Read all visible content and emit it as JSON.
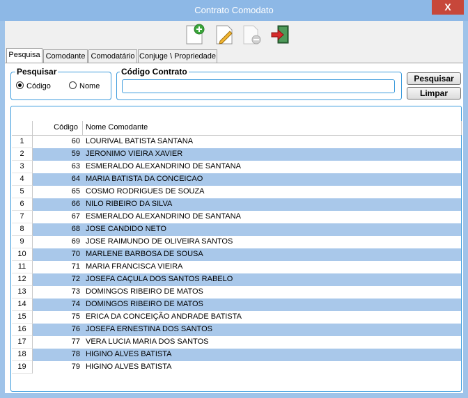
{
  "window": {
    "title": "Contrato Comodato",
    "close_label": "X"
  },
  "toolbar": {
    "buttons": [
      {
        "name": "add-document-icon"
      },
      {
        "name": "edit-document-icon"
      },
      {
        "name": "remove-document-icon"
      },
      {
        "name": "exit-icon"
      }
    ]
  },
  "tabs": [
    {
      "label": "Pesquisa",
      "active": true
    },
    {
      "label": "Comodante"
    },
    {
      "label": "Comodatário"
    },
    {
      "label": "Conjuge \\ Propriedade"
    }
  ],
  "search": {
    "group_label": "Pesquisar",
    "option_codigo": "Código",
    "option_nome": "Nome",
    "selected": "Código",
    "contract_label": "Código Contrato",
    "contract_value": "",
    "search_button": "Pesquisar",
    "clear_button": "Limpar"
  },
  "grid": {
    "headers": {
      "code": "Código",
      "name": "Nome Comodante"
    },
    "rows": [
      {
        "n": "1",
        "code": "60",
        "name": "LOURIVAL BATISTA SANTANA"
      },
      {
        "n": "2",
        "code": "59",
        "name": "JERONIMO VIEIRA XAVIER"
      },
      {
        "n": "3",
        "code": "63",
        "name": "ESMERALDO ALEXANDRINO DE SANTANA"
      },
      {
        "n": "4",
        "code": "64",
        "name": "MARIA BATISTA DA CONCEICAO"
      },
      {
        "n": "5",
        "code": "65",
        "name": "COSMO RODRIGUES DE SOUZA"
      },
      {
        "n": "6",
        "code": "66",
        "name": "NILO RIBEIRO DA SILVA"
      },
      {
        "n": "7",
        "code": "67",
        "name": "ESMERALDO ALEXANDRINO DE SANTANA"
      },
      {
        "n": "8",
        "code": "68",
        "name": "JOSE CANDIDO NETO"
      },
      {
        "n": "9",
        "code": "69",
        "name": "JOSE RAIMUNDO DE OLIVEIRA SANTOS"
      },
      {
        "n": "10",
        "code": "70",
        "name": "MARLENE BARBOSA DE SOUSA"
      },
      {
        "n": "11",
        "code": "71",
        "name": "MARIA FRANCISCA VIEIRA"
      },
      {
        "n": "12",
        "code": "72",
        "name": "JOSEFA CAÇULA DOS SANTOS RABELO"
      },
      {
        "n": "13",
        "code": "73",
        "name": "DOMINGOS RIBEIRO DE MATOS"
      },
      {
        "n": "14",
        "code": "74",
        "name": "DOMINGOS RIBEIRO DE MATOS"
      },
      {
        "n": "15",
        "code": "75",
        "name": "ERICA DA CONCEIÇÃO ANDRADE BATISTA"
      },
      {
        "n": "16",
        "code": "76",
        "name": "JOSEFA ERNESTINA DOS SANTOS"
      },
      {
        "n": "17",
        "code": "77",
        "name": "VERA LUCIA MARIA DOS SANTOS"
      },
      {
        "n": "18",
        "code": "78",
        "name": "HIGINO ALVES BATISTA"
      },
      {
        "n": "19",
        "code": "79",
        "name": "HIGINO ALVES BATISTA"
      }
    ]
  },
  "colors": {
    "title_bar": "#8db8e6",
    "close": "#c7473a",
    "accent": "#3c9bdc",
    "alt_row": "#a9c8ea"
  }
}
